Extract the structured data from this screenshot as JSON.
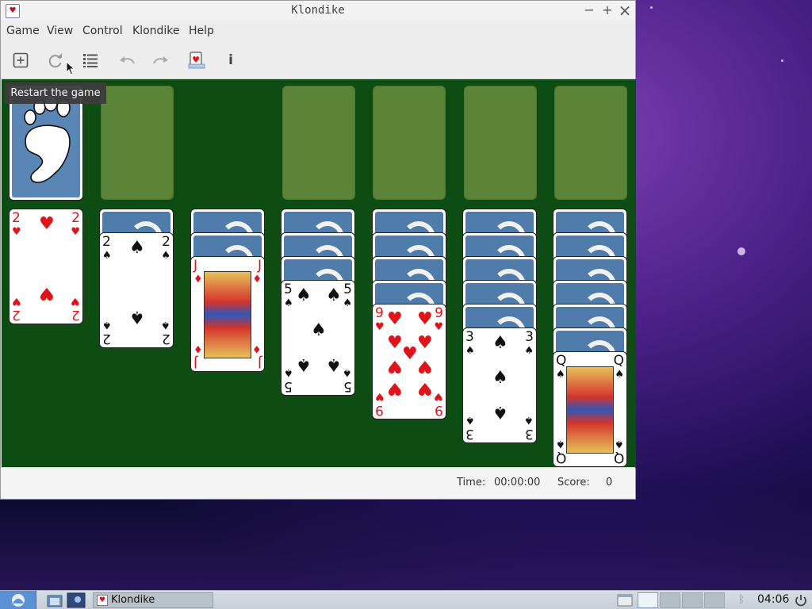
{
  "window": {
    "title": "Klondike",
    "controls": {
      "minimize": "−",
      "maximize": "+",
      "close": "×"
    }
  },
  "menu": [
    "Game",
    "View",
    "Control",
    "Klondike",
    "Help"
  ],
  "toolbar": {
    "tooltip": "Restart the game",
    "info_label": "i"
  },
  "tableau": [
    {
      "face_down": 0,
      "top": {
        "rank": "2",
        "suit": "♥",
        "color": "red"
      }
    },
    {
      "face_down": 1,
      "top": {
        "rank": "2",
        "suit": "♠",
        "color": "black"
      }
    },
    {
      "face_down": 2,
      "top": {
        "rank": "J",
        "suit": "♦",
        "color": "red"
      }
    },
    {
      "face_down": 3,
      "top": {
        "rank": "5",
        "suit": "♠",
        "color": "black"
      }
    },
    {
      "face_down": 4,
      "top": {
        "rank": "9",
        "suit": "♥",
        "color": "red"
      }
    },
    {
      "face_down": 5,
      "top": {
        "rank": "3",
        "suit": "♠",
        "color": "black"
      }
    },
    {
      "face_down": 6,
      "top": {
        "rank": "Q",
        "suit": "♠",
        "color": "black"
      }
    }
  ],
  "statusbar": {
    "time_label": "Time:",
    "time_value": "00:00:00",
    "score_label": "Score:",
    "score_value": "0"
  },
  "taskbar": {
    "task_title": "Klondike",
    "clock": "04:06"
  },
  "colors": {
    "felt": "#0d4d14",
    "slot": "#5b8438",
    "card_back": "#4f7cab",
    "red_suit": "#e0131a"
  }
}
